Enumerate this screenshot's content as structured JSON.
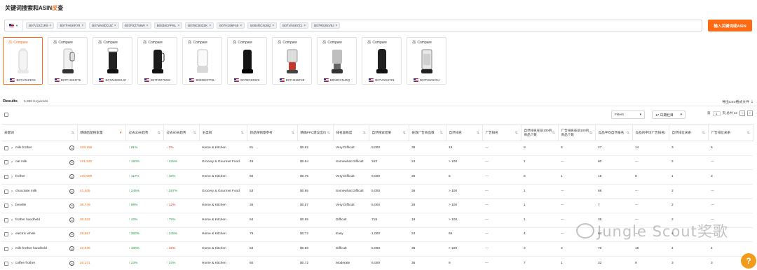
{
  "page": {
    "title_prefix": "关键词搜索和ASIN",
    "title_highlight": "反",
    "title_suffix": "查"
  },
  "search": {
    "marketplace": "US",
    "asins": [
      "B07V22Z1R9",
      "B07FHSKR76",
      "B07W48DGJZ",
      "B07PZZ756W",
      "B0838CFP8L",
      "B07BC833ZK",
      "B07H195F48",
      "B004RCNJ9Q",
      "B07VNS87Z1",
      "B07RS2NV9J"
    ],
    "submit_label": "输入关键词或ASIN"
  },
  "products": [
    {
      "compare": "Compare",
      "asin": "B07V22Z1R9",
      "active": true
    },
    {
      "compare": "Compare",
      "asin": "B07FHSKR76"
    },
    {
      "compare": "Compare",
      "asin": "B07W48DGJZ"
    },
    {
      "compare": "Compare",
      "asin": "B07PZZ756W"
    },
    {
      "compare": "Compare",
      "asin": "B0838CFP8L"
    },
    {
      "compare": "Compare",
      "asin": "B07BC833ZK"
    },
    {
      "compare": "Compare",
      "asin": "B07H195F48"
    },
    {
      "compare": "Compare",
      "asin": "B004RCNJ9Q"
    },
    {
      "compare": "Compare",
      "asin": "B07VNS87Z1"
    },
    {
      "compare": "Compare",
      "asin": "B07RS2NV9J"
    }
  ],
  "results": {
    "label": "Results",
    "count": "5,388 Keywords",
    "export": "导出CSV格式文件"
  },
  "toolbar": {
    "filters": "Filters",
    "period": "17 日期栏目",
    "page_prefix": "第",
    "page_value": "1",
    "page_suffix": "页,总共 22"
  },
  "columns": [
    "关键词",
    "精确匹配搜索量",
    "过去30天趋势",
    "过去90天趋势",
    "主类目",
    "新品保销量参考",
    "精确PPC建议出价",
    "排名容易度",
    "自然搜索结果",
    "投放广告商品数",
    "自然排名",
    "广告排名",
    "自然排名在前100的商品个数",
    "广告排名在前100的商品个数",
    "竞品平均自然排名",
    "竞品的平均广告排名",
    "自然排位关系",
    "广告排位关系"
  ],
  "rows": [
    {
      "kw": "milk frother",
      "vol": "338,159",
      "t30": "↑ 91%",
      "t30d": "up",
      "t90": "↓ 2%",
      "t90d": "down",
      "cat": "Home & Kitchen",
      "giveaway": "81",
      "ppc": "$0.62",
      "ease": "Very Difficult",
      "organic": "9,000",
      "sponsored": "36",
      "rank": "19",
      "arank": "---",
      "top100": "9",
      "atop100": "5",
      "avg": "27",
      "aavg": "14",
      "rel": "3",
      "arel": "6"
    },
    {
      "kw": "oat milk",
      "vol": "101,622",
      "t30": "↑ 150%",
      "t30d": "up",
      "t90": "↑ 428%",
      "t90d": "up",
      "cat": "Grocery & Gourmet Food",
      "giveaway": "49",
      "ppc": "$0.64",
      "ease": "Somewhat Difficult",
      "organic": "343",
      "sponsored": "24",
      "rank": "> 100",
      "arank": "---",
      "top100": "1",
      "atop100": "---",
      "avg": "80",
      "aavg": "---",
      "rel": "2",
      "arel": "---"
    },
    {
      "kw": "frother",
      "vol": "100,098",
      "t30": "↑ 117%",
      "t30d": "up",
      "t90": "↑ 48%",
      "t90d": "up",
      "cat": "Home & Kitchen",
      "giveaway": "66",
      "ppc": "$0.75",
      "ease": "Very Difficult",
      "organic": "9,000",
      "sponsored": "36",
      "rank": "5",
      "arank": "---",
      "top100": "8",
      "atop100": "1",
      "avg": "19",
      "aavg": "9",
      "rel": "1",
      "arel": "3"
    },
    {
      "kw": "chocolate milk",
      "vol": "41,405",
      "t30": "↑ 245%",
      "t30d": "up",
      "t90": "↑ 287%",
      "t90d": "up",
      "cat": "Grocery & Gourmet Food",
      "giveaway": "53",
      "ppc": "$0.95",
      "ease": "Somewhat Difficult",
      "organic": "5,000",
      "sponsored": "36",
      "rank": "> 100",
      "arank": "---",
      "top100": "1",
      "atop100": "---",
      "avg": "88",
      "aavg": "---",
      "rel": "2",
      "arel": "---"
    },
    {
      "kw": "breville",
      "vol": "36,749",
      "t30": "↑ 98%",
      "t30d": "up",
      "t90": "↓ 12%",
      "t90d": "down",
      "cat": "Home & Kitchen",
      "giveaway": "35",
      "ppc": "$0.57",
      "ease": "Very Difficult",
      "organic": "5,000",
      "sponsored": "28",
      "rank": "> 100",
      "arank": "---",
      "top100": "1",
      "atop100": "---",
      "avg": "7",
      "aavg": "---",
      "rel": "2",
      "arel": "---"
    },
    {
      "kw": "frother handheld",
      "vol": "30,022",
      "t30": "↑ 43%",
      "t30d": "up",
      "t90": "↑ 79%",
      "t90d": "up",
      "cat": "Home & Kitchen",
      "giveaway": "64",
      "ppc": "$0.55",
      "ease": "Difficult",
      "organic": "718",
      "sponsored": "18",
      "rank": "> 100",
      "arank": "---",
      "top100": "1",
      "atop100": "---",
      "avg": "35",
      "aavg": "---",
      "rel": "2",
      "arel": "---"
    },
    {
      "kw": "electric whisk",
      "vol": "29,667",
      "t30": "↑ 350%",
      "t30d": "up",
      "t90": "↑ 248%",
      "t90d": "up",
      "cat": "Home & Kitchen",
      "giveaway": "78",
      "ppc": "$0.72",
      "ease": "Easy",
      "organic": "1,000",
      "sponsored": "24",
      "rank": "66",
      "arank": "---",
      "top100": "4",
      "atop100": "---",
      "avg": "64",
      "aavg": "---",
      "rel": "4",
      "arel": "---"
    },
    {
      "kw": "milk frother handheld",
      "vol": "23,928",
      "t30": "↑ 180%",
      "t30d": "up",
      "t90": "↓ 16%",
      "t90d": "down",
      "cat": "Home & Kitchen",
      "giveaway": "53",
      "ppc": "$0.68",
      "ease": "Difficult",
      "organic": "5,000",
      "sponsored": "36",
      "rank": "> 100",
      "arank": "---",
      "top100": "2",
      "atop100": "3",
      "avg": "70",
      "aavg": "18",
      "rel": "4",
      "arel": "4"
    },
    {
      "kw": "coffee frother",
      "vol": "20,171",
      "t30": "↑ 23%",
      "t30d": "up",
      "t90": "↑ 34%",
      "t90d": "up",
      "cat": "Home & Kitchen",
      "giveaway": "60",
      "ppc": "$0.72",
      "ease": "Moderate",
      "organic": "6,000",
      "sponsored": "36",
      "rank": "9",
      "arank": "---",
      "top100": "7",
      "atop100": "1",
      "avg": "32",
      "aavg": "9",
      "rel": "3",
      "arel": "3"
    }
  ],
  "watermark": "Jungle Scout奖歌",
  "help_icon": "?"
}
